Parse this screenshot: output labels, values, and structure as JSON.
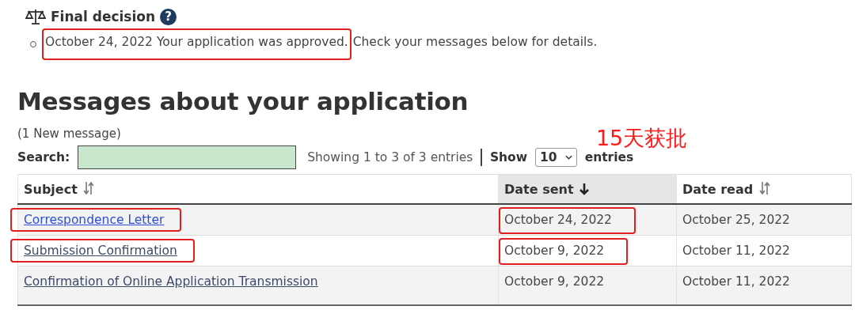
{
  "final_decision": {
    "title": "Final decision",
    "help_icon": "?",
    "items": [
      {
        "highlighted_text": "October 24, 2022 Your application was approved.",
        "rest_text": "Check your messages below for details.",
        "highlighted": true
      }
    ]
  },
  "messages": {
    "heading": "Messages about your application",
    "new_count": "(1 New message)",
    "annotation": "15天获批",
    "search": {
      "label": "Search:"
    },
    "info": "Showing 1 to 3 of 3 entries",
    "show_label": "Show",
    "page_size": "10",
    "entries_label": "entries",
    "table": {
      "columns": [
        {
          "label": "Subject",
          "sorted": false
        },
        {
          "label": "Date sent",
          "sorted": true
        },
        {
          "label": "Date read",
          "sorted": false
        }
      ],
      "rows": [
        {
          "subject": "Correspondence Letter",
          "visited": false,
          "subject_highlighted": true,
          "date_sent": "October 24, 2022",
          "date_highlighted": true,
          "date_read": "October 25, 2022"
        },
        {
          "subject": "Submission Confirmation",
          "visited": true,
          "subject_highlighted": true,
          "date_sent": "October 9, 2022",
          "date_highlighted": true,
          "date_read": "October 11, 2022"
        },
        {
          "subject": "Confirmation of Online Application Transmission",
          "visited": true,
          "subject_highlighted": false,
          "date_sent": "October 9, 2022",
          "date_highlighted": false,
          "date_read": "October 11, 2022"
        }
      ]
    }
  }
}
